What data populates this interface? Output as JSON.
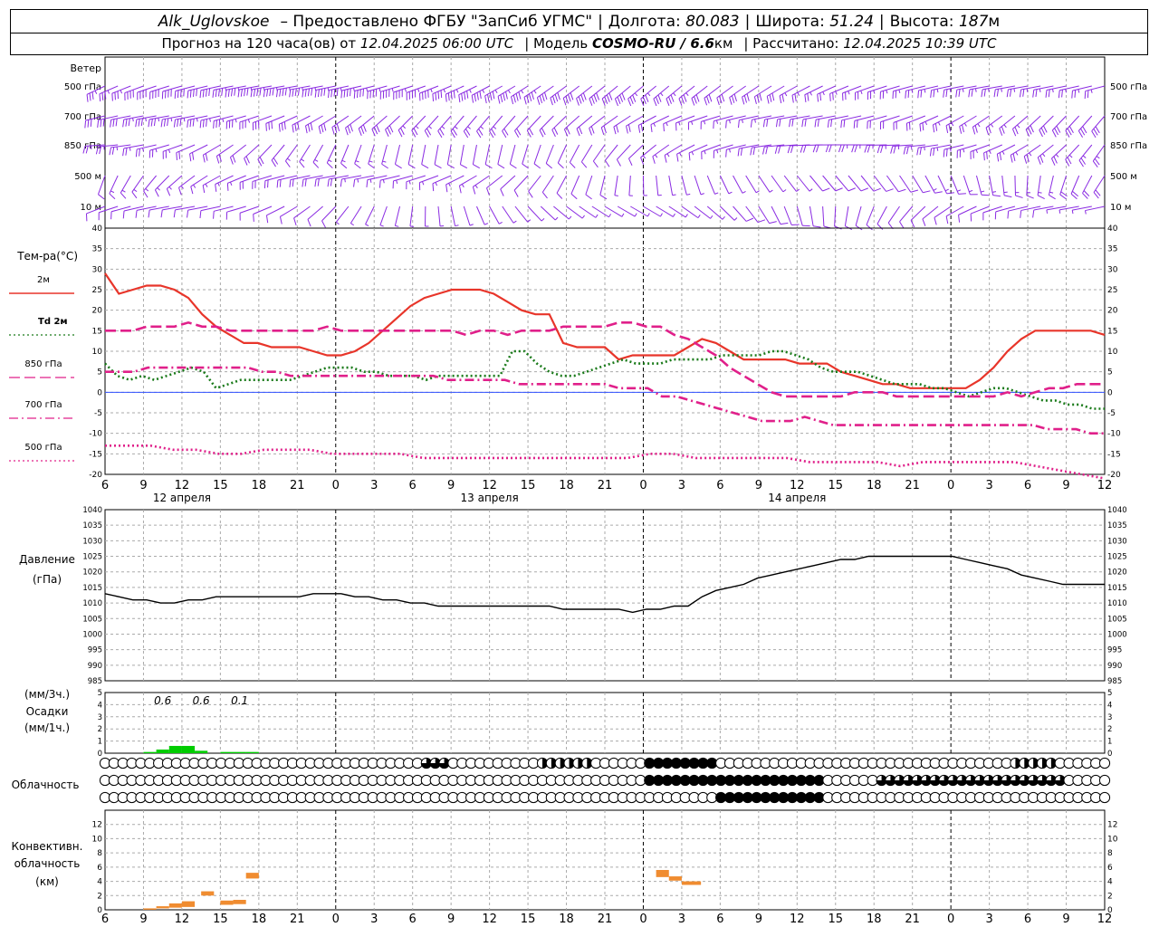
{
  "header": {
    "station": "Alk_Uglovskoe",
    "provider": "– Предоставлено ФГБУ \"ЗапСиб УГМС\"",
    "lon_label": "Долгота:",
    "lon": "80.083",
    "lat_label": "Широта:",
    "lat": "51.24",
    "alt_label": "Высота:",
    "alt": "187",
    "alt_unit": "м",
    "forecast_prefix": "Прогноз на 120 часа(ов) от",
    "forecast_start": "12.04.2025 06:00 UTC",
    "model_label": "| Модель",
    "model": "COSMO-RU / 6.6",
    "model_unit": "км",
    "calc_label": "| Рассчитано:",
    "calc_time": "12.04.2025 10:39 UTC"
  },
  "chart_data": {
    "x_tick_labels": [
      "6",
      "9",
      "12",
      "15",
      "18",
      "21",
      "0",
      "3",
      "6",
      "9",
      "12",
      "15",
      "18",
      "21",
      "0",
      "3",
      "6",
      "9",
      "12",
      "15",
      "18",
      "21",
      "0",
      "3",
      "6",
      "9",
      "12"
    ],
    "day_labels": [
      "12 апреля",
      "13 апреля",
      "14 апреля"
    ],
    "wind": {
      "title": "Ветер",
      "levels": [
        "500 гПа",
        "700 гПа",
        "850 гПа",
        "500 м",
        "10 м"
      ],
      "color": "#8a2be2"
    },
    "temperature": {
      "type": "line",
      "title": "Тем-ра(°C)",
      "ylim": [
        -20,
        40
      ],
      "yticks": [
        -20,
        -15,
        -10,
        -5,
        0,
        5,
        10,
        15,
        20,
        25,
        30,
        35,
        40
      ],
      "series": [
        {
          "name": "2м",
          "color": "#e8352a",
          "dash": "solid",
          "values": [
            29,
            24,
            25,
            26,
            26,
            25,
            23,
            19,
            16,
            14,
            12,
            12,
            11,
            11,
            11,
            10,
            9,
            9,
            10,
            12,
            15,
            18,
            21,
            23,
            24,
            25,
            25,
            25,
            24,
            22,
            20,
            19,
            19,
            12,
            11,
            11,
            11,
            8,
            9,
            9,
            9,
            9,
            11,
            13,
            12,
            10,
            8,
            8,
            8,
            8,
            7,
            7,
            7,
            5,
            4,
            3,
            2,
            2,
            1,
            1,
            1,
            1,
            1,
            3,
            6,
            10,
            13,
            15,
            15,
            15,
            15,
            15,
            14
          ]
        },
        {
          "name": "Td 2м",
          "color": "#1a7a1a",
          "dash": "dotted",
          "values": [
            7,
            4,
            3,
            4,
            3,
            4,
            5,
            6,
            5,
            1,
            2,
            3,
            3,
            3,
            3,
            3,
            4,
            5,
            6,
            6,
            6,
            5,
            5,
            4,
            4,
            4,
            3,
            4,
            4,
            4,
            4,
            4,
            4,
            10,
            10,
            7,
            5,
            4,
            4,
            5,
            6,
            7,
            8,
            7,
            7,
            7,
            8,
            8,
            8,
            8,
            9,
            9,
            9,
            9,
            10,
            10,
            9,
            8,
            6,
            5,
            5,
            5,
            4,
            3,
            2,
            2,
            2,
            1,
            1,
            0,
            -1,
            0,
            1,
            1,
            0,
            -1,
            -2,
            -2,
            -3,
            -3,
            -4,
            -4
          ]
        },
        {
          "name": "850 гПа",
          "color": "#e0208a",
          "dash": "longdash",
          "values": [
            15,
            15,
            15,
            16,
            16,
            16,
            17,
            16,
            16,
            15,
            15,
            15,
            15,
            15,
            15,
            15,
            16,
            15,
            15,
            15,
            15,
            15,
            15,
            15,
            15,
            15,
            14,
            15,
            15,
            14,
            15,
            15,
            15,
            16,
            16,
            16,
            16,
            17,
            17,
            16,
            16,
            14,
            13,
            11,
            9,
            6,
            4,
            2,
            0,
            -1,
            -1,
            -1,
            -1,
            -1,
            0,
            0,
            0,
            -1,
            -1,
            -1,
            -1,
            -1,
            -1,
            -1,
            -1,
            0,
            -1,
            0,
            1,
            1,
            2,
            2,
            2
          ]
        },
        {
          "name": "700 гПа",
          "color": "#e0208a",
          "dash": "dashdot",
          "values": [
            5,
            5,
            5,
            6,
            6,
            6,
            6,
            6,
            6,
            6,
            6,
            5,
            5,
            4,
            4,
            4,
            4,
            4,
            4,
            4,
            4,
            4,
            4,
            4,
            3,
            3,
            3,
            3,
            3,
            2,
            2,
            2,
            2,
            2,
            2,
            2,
            1,
            1,
            1,
            -1,
            -1,
            -2,
            -3,
            -4,
            -5,
            -6,
            -7,
            -7,
            -7,
            -6,
            -7,
            -8,
            -8,
            -8,
            -8,
            -8,
            -8,
            -8,
            -8,
            -8,
            -8,
            -8,
            -8,
            -8,
            -8,
            -8,
            -9,
            -9,
            -9,
            -10,
            -10
          ]
        },
        {
          "name": "500 гПа",
          "color": "#e0208a",
          "dash": "dotted",
          "values": [
            -13,
            -13,
            -13,
            -14,
            -14,
            -15,
            -15,
            -14,
            -14,
            -14,
            -15,
            -15,
            -15,
            -15,
            -16,
            -16,
            -16,
            -16,
            -16,
            -16,
            -16,
            -16,
            -16,
            -16,
            -15,
            -15,
            -16,
            -16,
            -16,
            -16,
            -16,
            -17,
            -17,
            -17,
            -17,
            -18,
            -17,
            -17,
            -17,
            -17,
            -17,
            -18,
            -19,
            -20,
            -21
          ]
        }
      ]
    },
    "pressure": {
      "type": "line",
      "title": "Давление",
      "unit": "(гПа)",
      "ylim": [
        985,
        1040
      ],
      "yticks": [
        985,
        990,
        995,
        1000,
        1005,
        1010,
        1015,
        1020,
        1025,
        1030,
        1035,
        1040
      ],
      "values": [
        1013,
        1012,
        1011,
        1011,
        1010,
        1010,
        1011,
        1011,
        1012,
        1012,
        1012,
        1012,
        1012,
        1012,
        1012,
        1013,
        1013,
        1013,
        1012,
        1012,
        1011,
        1011,
        1010,
        1010,
        1009,
        1009,
        1009,
        1009,
        1009,
        1009,
        1009,
        1009,
        1009,
        1008,
        1008,
        1008,
        1008,
        1008,
        1007,
        1008,
        1008,
        1009,
        1009,
        1012,
        1014,
        1015,
        1016,
        1018,
        1019,
        1020,
        1021,
        1022,
        1023,
        1024,
        1024,
        1025,
        1025,
        1025,
        1025,
        1025,
        1025,
        1025,
        1024,
        1023,
        1022,
        1021,
        1019,
        1018,
        1017,
        1016,
        1016,
        1016,
        1016
      ]
    },
    "precipitation": {
      "type": "bar",
      "title": "Осадки",
      "unit_top": "(мм/3ч.)",
      "unit_bottom": "(мм/1ч.)",
      "ylim": [
        0,
        5
      ],
      "yticks": [
        0,
        1,
        2,
        3,
        4,
        5
      ],
      "bars": [
        {
          "h": 3.0,
          "v": 0.1
        },
        {
          "h": 4.0,
          "v": 0.3
        },
        {
          "h": 5.0,
          "v": 0.6
        },
        {
          "h": 6.0,
          "v": 0.6
        },
        {
          "h": 7.0,
          "v": 0.2
        },
        {
          "h": 9.0,
          "v": 0.1
        },
        {
          "h": 10.0,
          "v": 0.1
        },
        {
          "h": 11.0,
          "v": 0.1
        }
      ],
      "labels": [
        {
          "h": 4.5,
          "text": "0.6"
        },
        {
          "h": 7.5,
          "text": "0.6"
        },
        {
          "h": 10.5,
          "text": "0.1"
        }
      ],
      "color": "#00cc00"
    },
    "clouds": {
      "title": "Облачность",
      "rows": [
        {
          "name": "upper",
          "values": [
            0,
            0,
            0,
            0,
            0,
            0,
            0,
            0,
            0,
            0,
            0,
            0,
            0,
            0,
            0,
            0,
            0,
            0,
            0,
            0,
            0,
            0,
            0,
            0,
            0,
            0,
            0,
            0,
            0,
            0,
            0,
            0,
            0,
            0,
            0,
            0,
            0,
            0,
            0,
            0,
            0,
            0,
            0,
            0,
            0,
            0,
            0,
            0,
            0,
            0,
            0,
            0,
            0,
            0,
            0,
            0,
            0,
            0,
            0,
            0,
            0,
            0,
            0,
            0,
            0,
            0,
            0,
            0,
            0,
            0,
            0,
            0,
            0,
            0,
            0,
            0,
            0,
            0,
            0,
            0,
            0,
            0,
            0,
            0,
            0,
            0,
            0,
            0,
            0,
            0,
            0,
            0,
            0,
            0,
            0,
            0,
            0,
            0,
            0,
            0,
            0,
            0,
            0,
            0,
            0,
            0,
            0,
            0,
            0,
            0,
            0,
            0
          ]
        },
        {
          "name": "middle",
          "values": [
            0,
            0,
            0,
            0,
            0,
            0,
            0,
            0,
            0,
            0,
            0,
            0,
            0,
            0,
            0,
            0,
            0,
            0,
            0,
            0,
            0,
            0,
            0,
            0,
            0,
            0,
            0,
            0,
            0,
            0,
            0,
            0,
            0,
            0,
            0,
            0,
            0,
            0,
            0,
            0,
            0,
            0,
            0,
            0,
            0,
            0,
            0,
            0,
            0,
            0,
            0,
            0,
            0,
            0,
            0,
            0,
            0,
            0,
            0,
            0,
            0,
            0,
            0,
            0,
            0,
            0,
            0,
            0,
            0,
            0,
            0,
            0,
            0,
            0,
            0,
            0,
            0,
            0,
            0,
            0,
            0,
            0,
            0,
            0,
            0,
            0,
            0,
            0,
            0,
            0,
            0,
            0,
            0,
            0,
            0,
            0,
            0,
            0,
            0,
            0,
            0,
            0,
            0,
            0,
            0,
            0,
            0,
            0,
            0,
            0,
            0,
            0
          ]
        },
        {
          "name": "lower",
          "values": [
            0,
            0,
            0,
            0,
            0,
            0,
            0,
            0,
            0,
            0,
            0,
            0,
            0,
            0,
            0,
            0,
            0,
            0,
            0,
            0,
            0,
            0,
            0,
            0,
            0,
            0,
            0,
            0,
            0,
            0,
            0,
            0,
            0,
            0,
            0,
            0,
            0,
            0,
            0,
            0,
            0,
            0,
            0,
            0,
            0,
            0,
            0,
            0,
            0,
            0,
            0,
            0,
            0,
            0,
            0,
            0,
            0,
            0,
            0,
            0,
            0,
            0,
            0,
            0,
            0,
            0,
            0,
            0,
            0,
            0,
            0,
            0,
            0,
            0,
            0,
            0,
            0,
            0,
            0,
            0,
            0,
            0,
            0,
            0,
            0,
            0,
            0,
            0,
            0,
            0,
            0,
            0,
            0,
            0,
            0,
            0,
            0,
            0,
            0,
            0,
            0,
            0,
            0,
            0,
            0,
            0,
            0,
            0,
            0,
            0,
            0,
            0
          ]
        }
      ]
    },
    "convective": {
      "type": "bar",
      "title": "Конвективн.",
      "title2": "облачность",
      "unit": "(км)",
      "ylim": [
        0,
        14
      ],
      "yticks": [
        0,
        2,
        4,
        6,
        8,
        10,
        12
      ],
      "bars": [
        {
          "h0": 3.0,
          "h1": 4.0,
          "base": 0.1,
          "top": 0.2
        },
        {
          "h0": 4.0,
          "h1": 5.0,
          "base": 0.2,
          "top": 0.5
        },
        {
          "h0": 5.0,
          "h1": 6.0,
          "base": 0.3,
          "top": 0.9
        },
        {
          "h0": 6.0,
          "h1": 7.0,
          "base": 0.4,
          "top": 1.2
        },
        {
          "h0": 7.5,
          "h1": 8.5,
          "base": 2.0,
          "top": 2.6
        },
        {
          "h0": 9.0,
          "h1": 10.0,
          "base": 0.7,
          "top": 1.3
        },
        {
          "h0": 10.0,
          "h1": 11.0,
          "base": 0.8,
          "top": 1.4
        },
        {
          "h0": 11.0,
          "h1": 12.0,
          "base": 4.4,
          "top": 5.2
        },
        {
          "h0": 43.0,
          "h1": 44.0,
          "base": 4.6,
          "top": 5.6
        },
        {
          "h0": 44.0,
          "h1": 45.0,
          "base": 4.1,
          "top": 4.7
        },
        {
          "h0": 45.0,
          "h1": 46.5,
          "base": 3.5,
          "top": 4.0
        }
      ],
      "color": "#f08c30"
    }
  }
}
